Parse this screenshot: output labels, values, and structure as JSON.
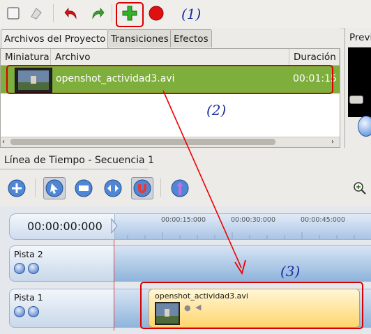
{
  "toolbar": {
    "icons": [
      "new-project-icon",
      "clear-icon",
      "undo-icon",
      "redo-icon",
      "add-file-icon",
      "record-icon"
    ],
    "annotation_1": "(1)"
  },
  "project_panel": {
    "tabs": [
      {
        "label": "Archivos del Proyecto",
        "active": true
      },
      {
        "label": "Transiciones",
        "active": false
      },
      {
        "label": "Efectos",
        "active": false
      }
    ],
    "columns": [
      "Miniatura",
      "Archivo",
      "Duración"
    ],
    "files": [
      {
        "name": "openshot_actividad3.avi",
        "duration": "00:01:15"
      }
    ],
    "annotation_2": "(2)"
  },
  "preview": {
    "title_partial": "Previ"
  },
  "timeline": {
    "title": "Línea de Tiempo - Secuencia 1",
    "timecode": "00:00:00:000",
    "ruler_ticks": [
      "00:00:15:000",
      "00:00:30:000",
      "00:00:45:000"
    ],
    "tracks": [
      {
        "name": "Pista 2"
      },
      {
        "name": "Pista 1"
      }
    ],
    "clip_name": "openshot_actividad3.avi",
    "annotation_3": "(3)"
  },
  "colors": {
    "highlight_red": "#d80000",
    "annotation_blue": "#1b2fa0",
    "selected_row_green": "#7eae3c"
  }
}
